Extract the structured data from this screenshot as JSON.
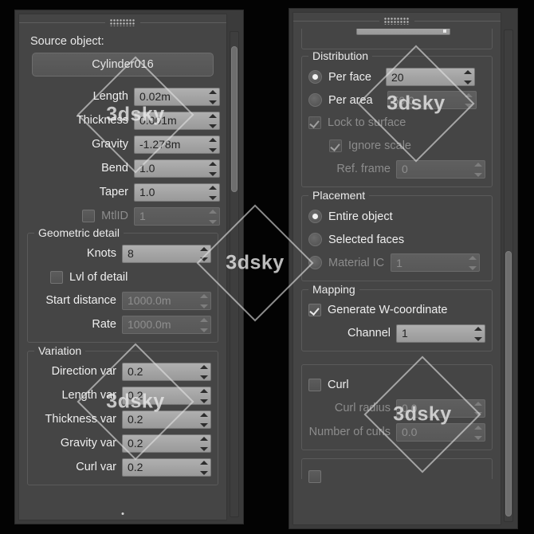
{
  "app": {
    "accent_color": "#454545",
    "panel_color": "#3b3b3b",
    "field_color": "#9a9a9a"
  },
  "watermark": {
    "text": "3dsky",
    "count": 5
  },
  "left_panel": {
    "source_object": {
      "label": "Source object:",
      "button_label": "Cylinder016"
    },
    "main_params": [
      {
        "caption": "Length",
        "value": "0.02m",
        "enabled": true,
        "checkbox": null
      },
      {
        "caption": "Thickness",
        "value": "0.001m",
        "enabled": true,
        "checkbox": null
      },
      {
        "caption": "Gravity",
        "value": "-1.278m",
        "enabled": true,
        "checkbox": null
      },
      {
        "caption": "Bend",
        "value": "1.0",
        "enabled": true,
        "checkbox": null
      },
      {
        "caption": "Taper",
        "value": "1.0",
        "enabled": true,
        "checkbox": null
      },
      {
        "caption": "MtlID",
        "value": "1",
        "enabled": false,
        "checkbox": false
      }
    ],
    "geometric_detail": {
      "title": "Geometric detail",
      "knots": {
        "caption": "Knots",
        "value": "8",
        "enabled": true
      },
      "lvl_of_detail": {
        "label": "Lvl of detail",
        "checked": false
      },
      "start_distance": {
        "caption": "Start distance",
        "value": "1000.0m",
        "enabled": false
      },
      "rate": {
        "caption": "Rate",
        "value": "1000.0m",
        "enabled": false
      }
    },
    "variation": {
      "title": "Variation",
      "rows": [
        {
          "caption": "Direction var",
          "value": "0.2"
        },
        {
          "caption": "Length var",
          "value": "0.2"
        },
        {
          "caption": "Thickness var",
          "value": "0.2"
        },
        {
          "caption": "Gravity var",
          "value": "0.2"
        },
        {
          "caption": "Curl var",
          "value": "0.2"
        }
      ]
    },
    "scrollbar": {
      "thumb_top_pct": 3,
      "thumb_height_pct": 30
    }
  },
  "right_panel": {
    "distribution": {
      "title": "Distribution",
      "per_face": {
        "label": "Per face",
        "selected": true,
        "value": "20",
        "field_enabled": true
      },
      "per_area": {
        "label": "Per area",
        "selected": false,
        "value": "50.0",
        "field_enabled": false
      },
      "lock_to_surface": {
        "label": "Lock to surface",
        "checked": true,
        "enabled": false
      },
      "ignore_scale": {
        "label": "Ignore scale",
        "checked": true,
        "enabled": false
      },
      "ref_frame": {
        "caption": "Ref. frame",
        "value": "0",
        "enabled": false
      }
    },
    "placement": {
      "title": "Placement",
      "options": [
        {
          "label": "Entire object",
          "selected": true
        },
        {
          "label": "Selected faces",
          "selected": false
        }
      ],
      "material_id": {
        "label": "Material IC",
        "selected": false,
        "value": "1",
        "field_enabled": false
      }
    },
    "mapping": {
      "title": "Mapping",
      "generate_w": {
        "label": "Generate W-coordinate",
        "checked": true
      },
      "channel": {
        "caption": "Channel",
        "value": "1",
        "enabled": true
      }
    },
    "curl": {
      "curl": {
        "label": "Curl",
        "checked": false
      },
      "curl_radius": {
        "caption": "Curl radius",
        "value": "0.0",
        "enabled": false
      },
      "number_of_curls": {
        "caption": "Number of curls",
        "value": "0.0",
        "enabled": false
      }
    },
    "scrollbar": {
      "thumb_top_pct": 45,
      "thumb_height_pct": 54
    }
  }
}
